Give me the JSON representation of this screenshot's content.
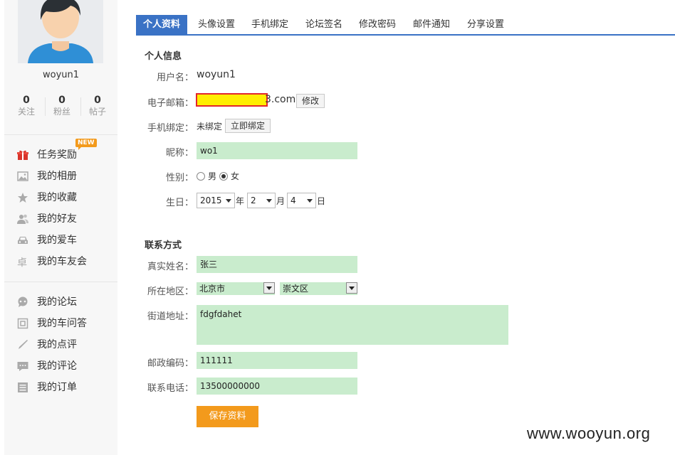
{
  "sidebar": {
    "username": "woyun1",
    "stats": [
      {
        "num": "0",
        "label": "关注"
      },
      {
        "num": "0",
        "label": "粉丝"
      },
      {
        "num": "0",
        "label": "帖子"
      }
    ],
    "new_badge": "NEW",
    "group1": [
      {
        "label": "任务奖励",
        "icon": "gift-icon"
      },
      {
        "label": "我的相册",
        "icon": "photo-icon"
      },
      {
        "label": "我的收藏",
        "icon": "star-icon"
      },
      {
        "label": "我的好友",
        "icon": "friends-icon"
      },
      {
        "label": "我的爱车",
        "icon": "car-icon"
      },
      {
        "label": "我的车友会",
        "icon": "club-icon"
      }
    ],
    "group2": [
      {
        "label": "我的论坛",
        "icon": "forum-icon"
      },
      {
        "label": "我的车问答",
        "icon": "qa-icon"
      },
      {
        "label": "我的点评",
        "icon": "pen-icon"
      },
      {
        "label": "我的评论",
        "icon": "comment-icon"
      },
      {
        "label": "我的订单",
        "icon": "order-icon"
      }
    ]
  },
  "tabs": [
    "个人资料",
    "头像设置",
    "手机绑定",
    "论坛签名",
    "修改密码",
    "邮件通知",
    "分享设置"
  ],
  "personal": {
    "section_title": "个人信息",
    "username_label": "用户名：",
    "username_value": "woyun1",
    "email_label": "电子邮箱：",
    "email_suffix": "3.com",
    "email_edit_button": "修改",
    "phone_label": "手机绑定：",
    "phone_status": "未绑定",
    "phone_bind_button": "立即绑定",
    "nickname_label": "昵称：",
    "nickname_value": "wo1",
    "gender_label": "性别：",
    "gender_male": "男",
    "gender_female": "女",
    "gender_selected": "女",
    "birthday_label": "生日：",
    "birth_year": "2015",
    "birth_year_unit": "年",
    "birth_month": "2",
    "birth_month_unit": "月",
    "birth_day": "4",
    "birth_day_unit": "日"
  },
  "contact": {
    "section_title": "联系方式",
    "realname_label": "真实姓名：",
    "realname_value": "张三",
    "region_label": "所在地区：",
    "city": "北京市",
    "district": "崇文区",
    "street_label": "街道地址：",
    "street_value": "fdgfdahet",
    "postcode_label": "邮政编码：",
    "postcode_value": "111111",
    "phone_label": "联系电话：",
    "phone_value": "13500000000"
  },
  "save_button": "保存资料",
  "watermark": "www.wooyun.org",
  "colors": {
    "accent": "#3a72c5",
    "save": "#f39a1c",
    "input_bg": "#c9eccd"
  }
}
